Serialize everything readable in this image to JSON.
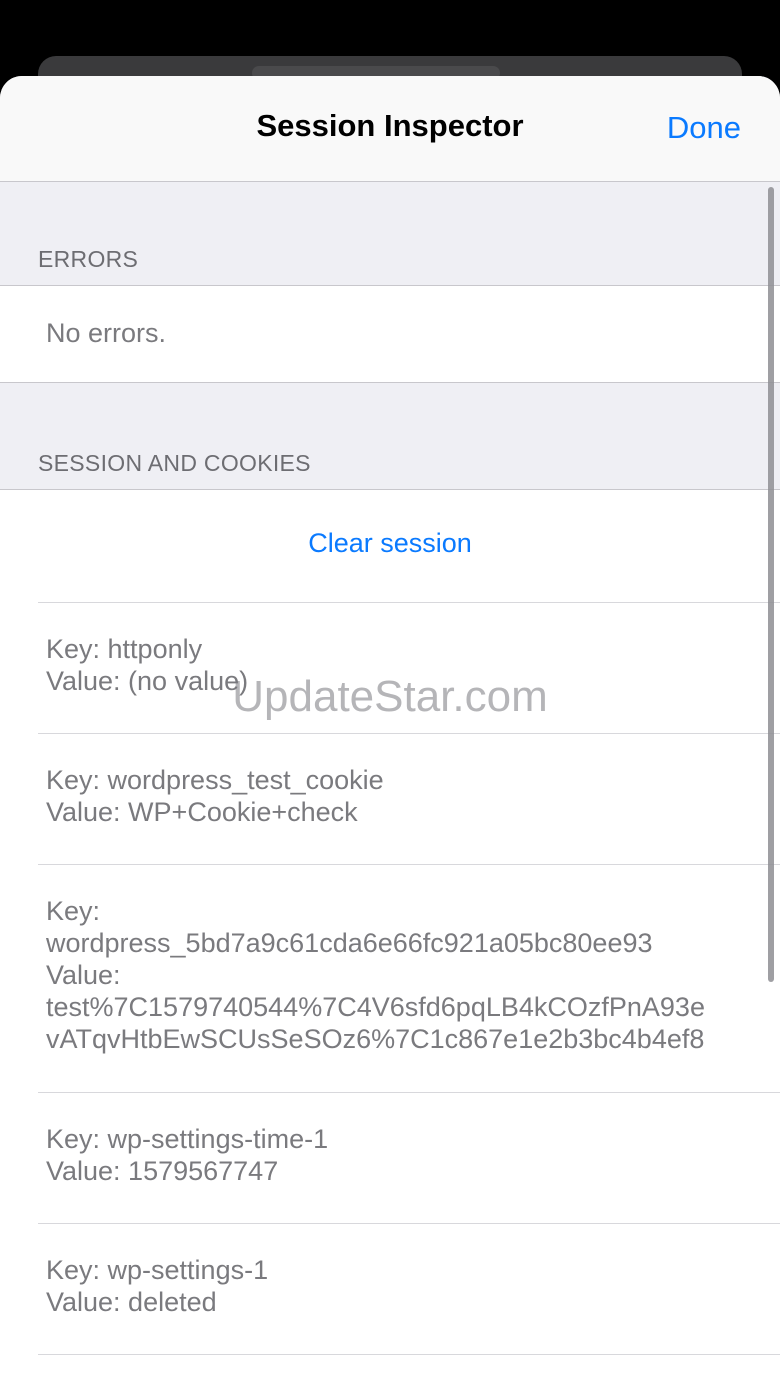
{
  "nav": {
    "title": "Session Inspector",
    "done_label": "Done"
  },
  "errors": {
    "header": "ERRORS",
    "message": "No errors."
  },
  "session": {
    "header": "SESSION AND COOKIES",
    "clear_label": "Clear session",
    "cookies": [
      {
        "key_line": "Key: httponly",
        "value_line": "Value: (no value)"
      },
      {
        "key_line": "Key: wordpress_test_cookie",
        "value_line": "Value: WP+Cookie+check"
      },
      {
        "key_label": "Key:",
        "key": "wordpress_5bd7a9c61cda6e66fc921a05bc80ee93",
        "value_label": "Value:",
        "value_part1": "test%7C1579740544%7C4V6sfd6pqLB4kCOzfPnA93e",
        "value_part2": "vATqvHtbEwSCUsSeSOz6%7C1c867e1e2b3bc4b4ef8"
      },
      {
        "key_line": "Key: wp-settings-time-1",
        "value_line": "Value: 1579567747"
      },
      {
        "key_line": "Key: wp-settings-1",
        "value_line": "Value: deleted"
      }
    ]
  },
  "watermark": "UpdateStar.com",
  "colors": {
    "accent": "#0a7aff",
    "grouped_background": "#efeff4",
    "secondary_text": "#6d6d72"
  }
}
